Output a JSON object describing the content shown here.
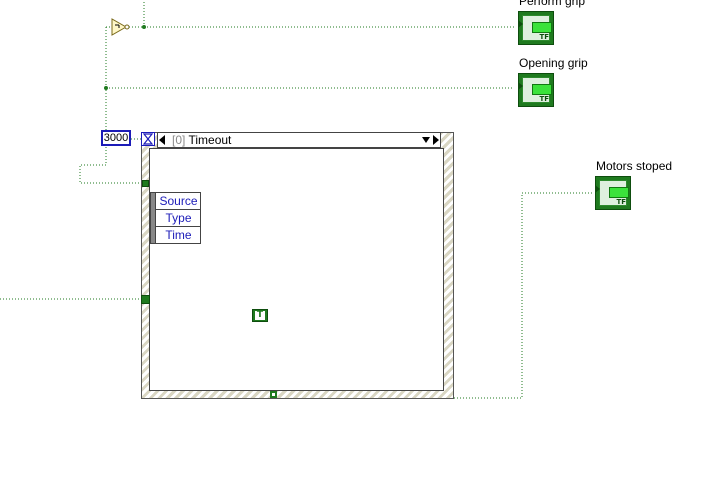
{
  "diagram": {
    "indicators": [
      {
        "id": "perform",
        "label": "Perform grip",
        "tf_text": "TF"
      },
      {
        "id": "opening",
        "label": "Opening grip",
        "tf_text": "TF"
      },
      {
        "id": "motors",
        "label": "Motors stoped",
        "tf_text": "TF"
      }
    ],
    "timeout_constant": "3000",
    "event_structure": {
      "case_index": "[0]",
      "case_name": "Timeout",
      "event_data_nodes": [
        "Source",
        "Type",
        "Time"
      ]
    },
    "true_constant": "T"
  }
}
